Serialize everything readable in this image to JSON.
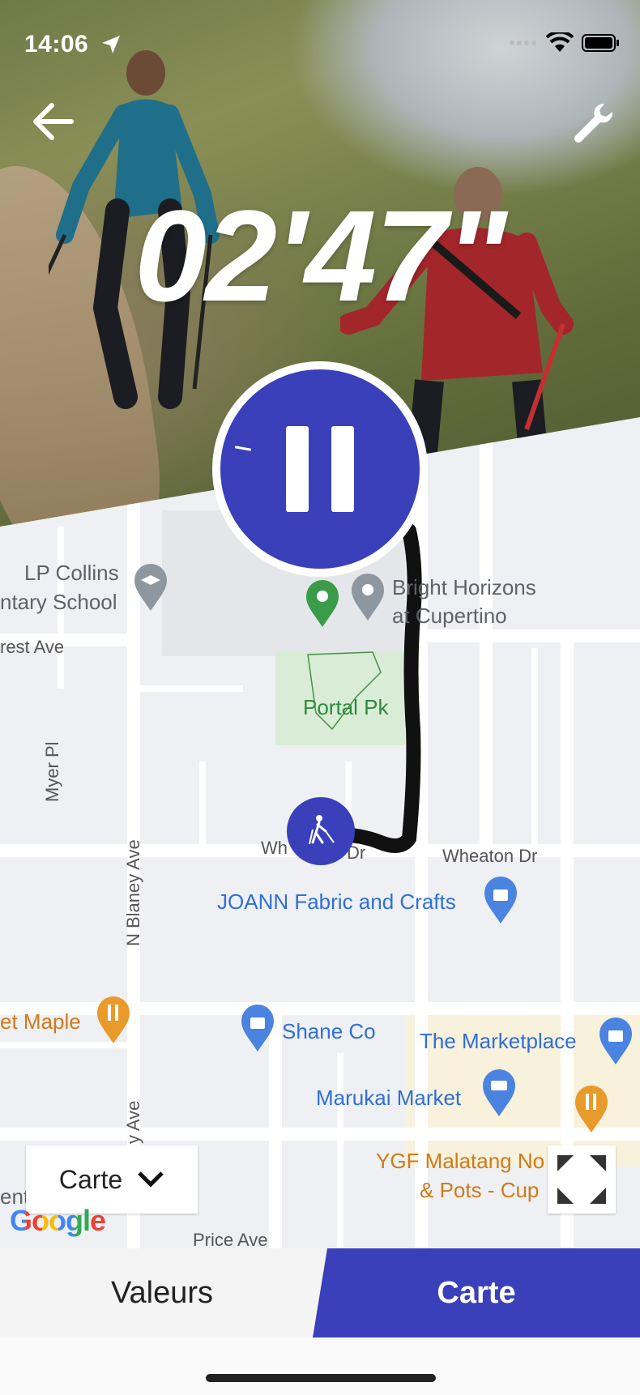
{
  "status_bar": {
    "time": "14:06"
  },
  "workout": {
    "timer": "02'47\""
  },
  "icons": {
    "back": "arrow-left-icon",
    "settings": "wrench-icon",
    "pause": "pause-icon",
    "walker": "nordic-walker-icon",
    "fullscreen": "fullscreen-icon",
    "dropdown": "chevron-down-icon"
  },
  "map": {
    "places": {
      "lp_collins_1": "LP Collins",
      "lp_collins_2": "ntary School",
      "bright_horizons_1": "Bright Horizons",
      "bright_horizons_2": "at Cupertino",
      "portal_pk": "Portal Pk",
      "joann": "JOANN Fabric and Crafts",
      "maple": "et Maple",
      "shane": "Shane Co",
      "marketplace": "The Marketplace",
      "marukai": "Marukai Market",
      "ygf_1": "YGF Malatang No",
      "ygf_2": "& Pots - Cup",
      "ent": "ent"
    },
    "streets": {
      "forest": "rest Ave",
      "myer": "Myer Pl",
      "n_blaney": "N Blaney Ave",
      "blaney_lower": "y Ave",
      "wheaton_left": "Wh",
      "wheaton_left_dr": "Dr",
      "wheaton_right": "Wheaton Dr",
      "price": "Price Ave"
    },
    "map_type_label": "Carte",
    "attribution": "Google"
  },
  "tabs": {
    "values": "Valeurs",
    "map": "Carte"
  },
  "colors": {
    "accent": "#3a3fba",
    "track": "#111111"
  }
}
